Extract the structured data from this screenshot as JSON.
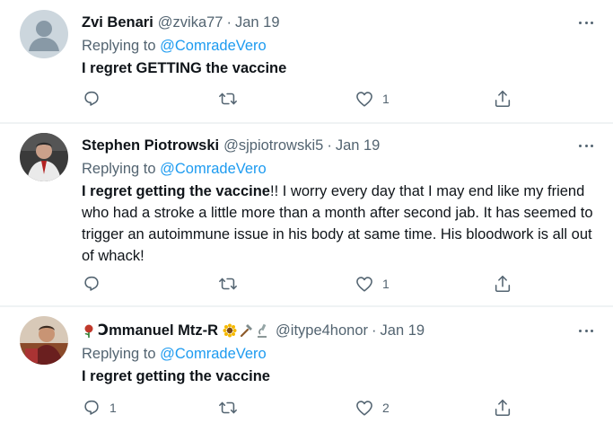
{
  "tweets": [
    {
      "display_name": "Zvi Benari",
      "handle": "@zvika77",
      "separator": "·",
      "date": "Jan 19",
      "replying_prefix": "Replying to ",
      "replying_to": "@ComradeVero",
      "text_bold": "I regret GETTING the vaccine",
      "text_rest": "",
      "reply_count": "",
      "retweet_count": "",
      "like_count": "1"
    },
    {
      "display_name": "Stephen Piotrowski",
      "handle": "@sjpiotrowski5",
      "separator": "·",
      "date": "Jan 19",
      "replying_prefix": "Replying to ",
      "replying_to": "@ComradeVero",
      "text_bold": "I regret getting the vaccine",
      "text_rest": "!!  I worry every day that I may end like my friend who had a stroke a little more than a month after second jab.  It has seemed to trigger an autoimmune issue in his body at same time.  His bloodwork is all out of whack!",
      "reply_count": "",
      "retweet_count": "",
      "like_count": "1"
    },
    {
      "display_name_symbol": "Ↄ",
      "display_name": "mmanuel Mtz-R",
      "handle": "@itype4honor",
      "separator": "·",
      "date": "Jan 19",
      "replying_prefix": "Replying to ",
      "replying_to": "@ComradeVero",
      "text_bold": "I regret getting the vaccine",
      "text_rest": "",
      "reply_count": "1",
      "retweet_count": "",
      "like_count": "2"
    }
  ],
  "icons": {
    "reply": "reply-icon",
    "retweet": "retweet-icon",
    "like": "heart-icon",
    "share": "share-icon",
    "more": "more-icon"
  },
  "colors": {
    "mention": "#1d9bf0",
    "secondary_text": "#536471",
    "primary_text": "#0f1419",
    "divider": "#eff3f4"
  }
}
